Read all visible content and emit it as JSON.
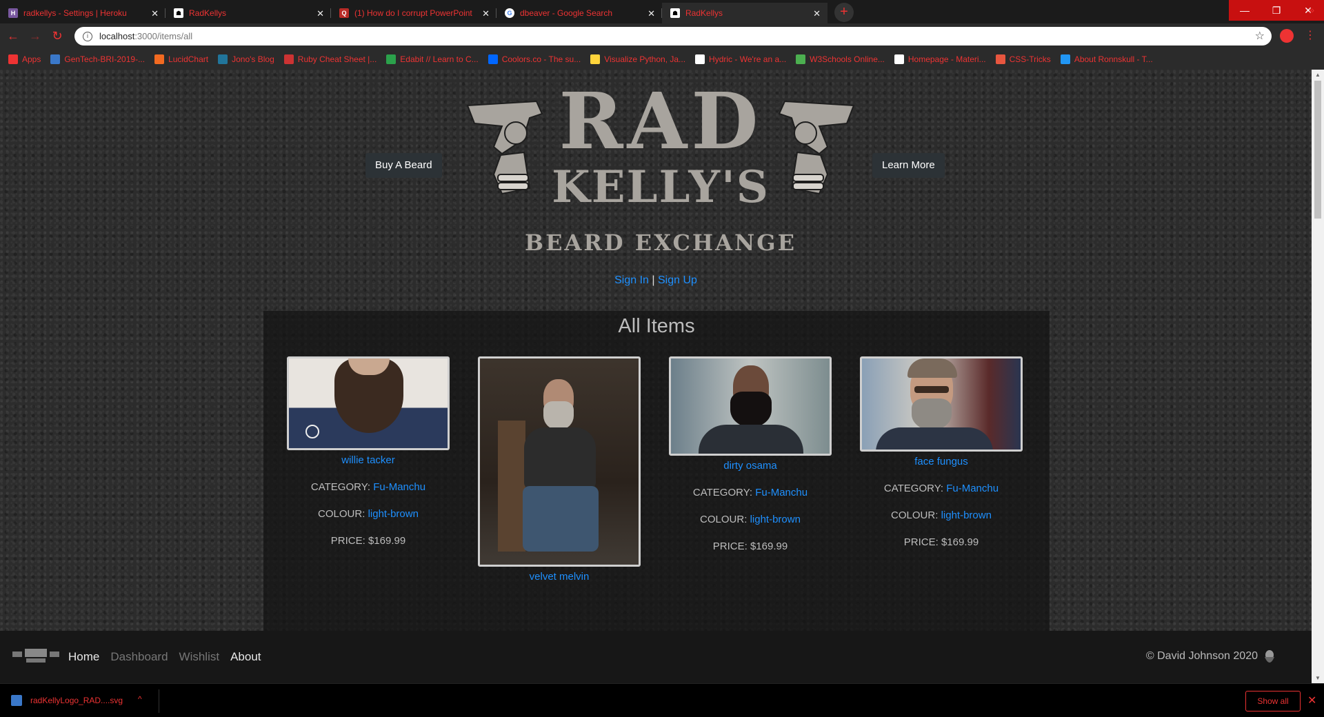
{
  "browser": {
    "tabs": [
      {
        "title": "radkellys - Settings | Heroku",
        "icon_color": "#79589f",
        "icon_letter": "H"
      },
      {
        "title": "RadKellys",
        "icon_color": "#ffffff",
        "icon_letter": "☗"
      },
      {
        "title": "(1) How do I corrupt PowerPoint",
        "icon_color": "#b92b27",
        "icon_letter": "Q"
      },
      {
        "title": "dbeaver - Google Search",
        "icon_color": "#4285f4",
        "icon_letter": "G"
      },
      {
        "title": "RadKellys",
        "icon_color": "#ffffff",
        "icon_letter": "☗"
      }
    ],
    "active_tab_index": 4,
    "url_host": "localhost",
    "url_rest": ":3000/items/all",
    "bookmarks": [
      {
        "label": "Apps",
        "icon_color": "#e33"
      },
      {
        "label": "GenTech-BRI-2019-...",
        "icon_color": "#3a78c9"
      },
      {
        "label": "LucidChart",
        "icon_color": "#f26a21"
      },
      {
        "label": "Jono's Blog",
        "icon_color": "#21759b"
      },
      {
        "label": "Ruby Cheat Sheet |...",
        "icon_color": "#c33"
      },
      {
        "label": "Edabit // Learn to C...",
        "icon_color": "#2ba14b"
      },
      {
        "label": "Coolors.co - The su...",
        "icon_color": "#0066ff"
      },
      {
        "label": "Visualize Python, Ja...",
        "icon_color": "#ffd43b"
      },
      {
        "label": "Hydric - We're an a...",
        "icon_color": "#ffffff"
      },
      {
        "label": "W3Schools Online...",
        "icon_color": "#4caf50"
      },
      {
        "label": "Homepage - Materi...",
        "icon_color": "#ffffff"
      },
      {
        "label": "CSS-Tricks",
        "icon_color": "#e8563f"
      },
      {
        "label": "About Ronnskull - T...",
        "icon_color": "#2196f3"
      }
    ]
  },
  "header": {
    "buy_label": "Buy A Beard",
    "learn_label": "Learn More",
    "logo_line1": "RAD",
    "logo_line2": "KELLY'S",
    "logo_line3": "BEARD EXCHANGE",
    "sign_in": "Sign In",
    "separator": "|",
    "sign_up": "Sign Up"
  },
  "main": {
    "title": "All Items",
    "category_label": "CATEGORY:",
    "colour_label": "COLOUR:",
    "price_label": "PRICE:",
    "items": [
      {
        "name": "willie tacker",
        "category": "Fu-Manchu",
        "colour": "light-brown",
        "price": "$169.99"
      },
      {
        "name": "velvet melvin"
      },
      {
        "name": "dirty osama",
        "category": "Fu-Manchu",
        "colour": "light-brown",
        "price": "$169.99"
      },
      {
        "name": "face fungus",
        "category": "Fu-Manchu",
        "colour": "light-brown",
        "price": "$169.99"
      }
    ]
  },
  "footer": {
    "nav": [
      "Home",
      "Dashboard",
      "Wishlist",
      "About"
    ],
    "active_nav": "Home",
    "copyright": "© David Johnson 2020"
  },
  "downloads": {
    "filename": "radKellyLogo_RAD....svg",
    "show_all": "Show all"
  },
  "colors": {
    "browser_accent": "#ee3333",
    "link": "#1e90ff",
    "page_bg": "#2c2c2c"
  }
}
